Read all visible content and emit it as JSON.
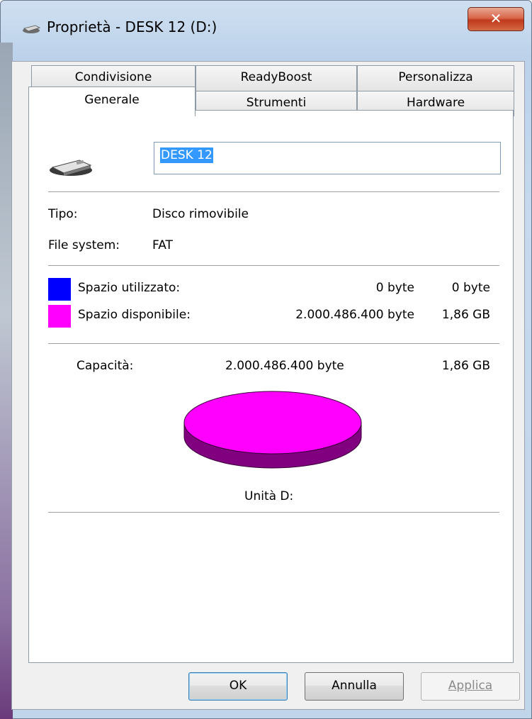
{
  "window": {
    "title": "Proprietà - DESK 12 (D:)",
    "close_glyph": "✕"
  },
  "tabs_row1": [
    "Condivisione",
    "ReadyBoost",
    "Personalizza"
  ],
  "tabs_row2": [
    "Generale",
    "Strumenti",
    "Hardware"
  ],
  "active_tab": "Generale",
  "volume": {
    "label_value": "DESK 12"
  },
  "info": {
    "type_label": "Tipo:",
    "type_value": "Disco rimovibile",
    "fs_label": "File system:",
    "fs_value": "FAT"
  },
  "space": {
    "used_label": "Spazio utilizzato:",
    "used_bytes": "0 byte",
    "used_short": "0 byte",
    "used_color": "#0000ff",
    "free_label": "Spazio disponibile:",
    "free_bytes": "2.000.486.400 byte",
    "free_short": "1,86 GB",
    "free_color": "#ff00ff"
  },
  "capacity": {
    "label": "Capacità:",
    "bytes": "2.000.486.400 byte",
    "short": "1,86 GB"
  },
  "drive_caption": "Unità D:",
  "buttons": {
    "ok": "OK",
    "cancel": "Annulla",
    "apply": "Applica"
  },
  "icons": {
    "drive": "removable-drive-icon"
  }
}
